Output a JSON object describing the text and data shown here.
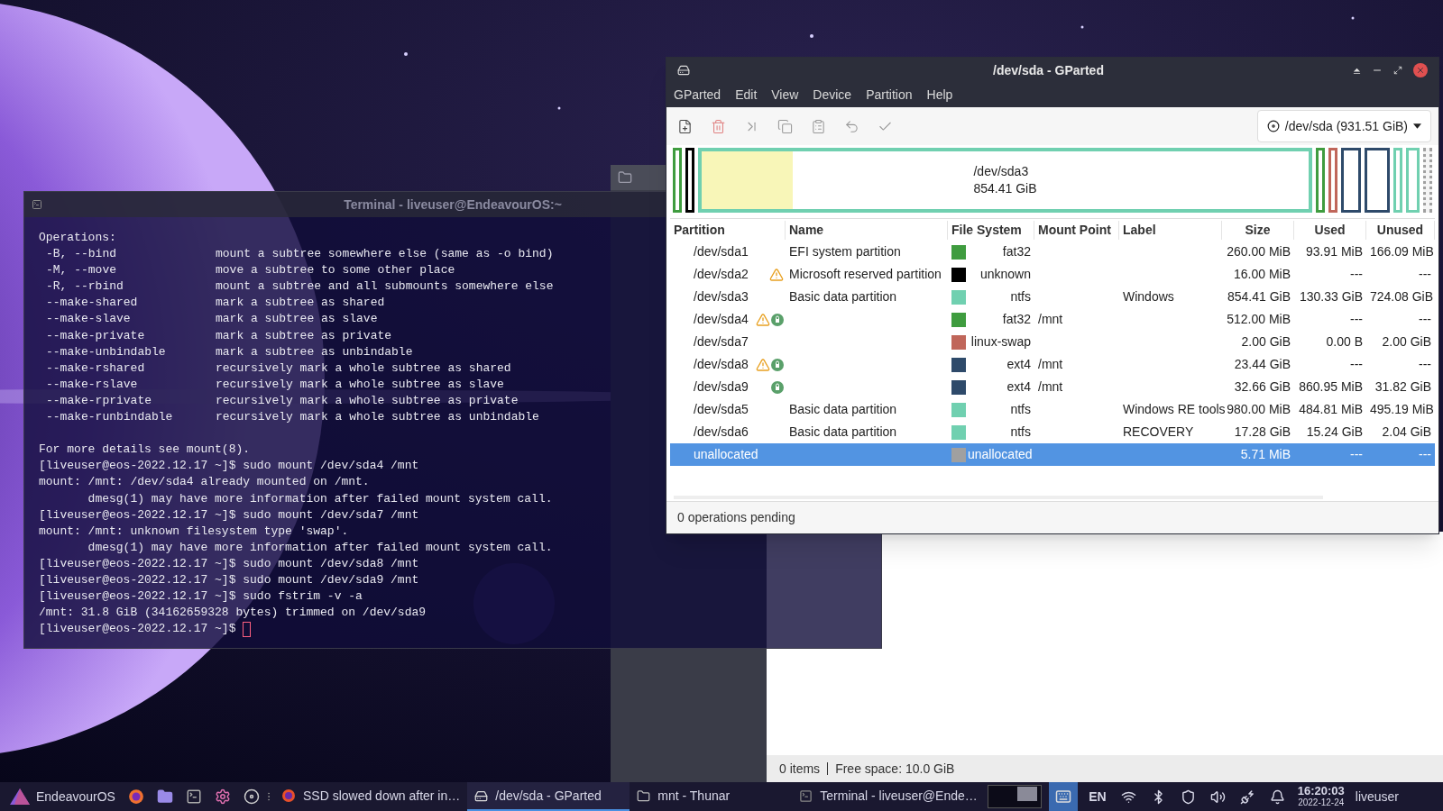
{
  "terminal": {
    "title": "Terminal - liveuser@EndeavourOS:~",
    "lines": [
      {
        "kind": "text",
        "text": "Operations:"
      },
      {
        "kind": "option",
        "option": "-B, --bind",
        "description": "mount a subtree somewhere else (same as -o bind)"
      },
      {
        "kind": "option",
        "option": "-M, --move",
        "description": "move a subtree to some other place"
      },
      {
        "kind": "option",
        "option": "-R, --rbind",
        "description": "mount a subtree and all submounts somewhere else"
      },
      {
        "kind": "option",
        "option": "--make-shared",
        "description": "mark a subtree as shared"
      },
      {
        "kind": "option",
        "option": "--make-slave",
        "description": "mark a subtree as slave"
      },
      {
        "kind": "option",
        "option": "--make-private",
        "description": "mark a subtree as private"
      },
      {
        "kind": "option",
        "option": "--make-unbindable",
        "description": "mark a subtree as unbindable"
      },
      {
        "kind": "option",
        "option": "--make-rshared",
        "description": "recursively mark a whole subtree as shared"
      },
      {
        "kind": "option",
        "option": "--make-rslave",
        "description": "recursively mark a whole subtree as slave"
      },
      {
        "kind": "option",
        "option": "--make-rprivate",
        "description": "recursively mark a whole subtree as private"
      },
      {
        "kind": "option",
        "option": "--make-runbindable",
        "description": "recursively mark a whole subtree as unbindable"
      },
      {
        "kind": "gap"
      },
      {
        "kind": "text",
        "text": "For more details see mount(8)."
      },
      {
        "kind": "text",
        "text": "[liveuser@eos-2022.12.17 ~]$ sudo mount /dev/sda4 /mnt"
      },
      {
        "kind": "text",
        "text": "mount: /mnt: /dev/sda4 already mounted on /mnt."
      },
      {
        "kind": "text",
        "text": "       dmesg(1) may have more information after failed mount system call."
      },
      {
        "kind": "text",
        "text": "[liveuser@eos-2022.12.17 ~]$ sudo mount /dev/sda7 /mnt"
      },
      {
        "kind": "text",
        "text": "mount: /mnt: unknown filesystem type 'swap'."
      },
      {
        "kind": "text",
        "text": "       dmesg(1) may have more information after failed mount system call."
      },
      {
        "kind": "text",
        "text": "[liveuser@eos-2022.12.17 ~]$ sudo mount /dev/sda8 /mnt"
      },
      {
        "kind": "text",
        "text": "[liveuser@eos-2022.12.17 ~]$ sudo mount /dev/sda9 /mnt"
      },
      {
        "kind": "text",
        "text": "[liveuser@eos-2022.12.17 ~]$ sudo fstrim -v -a"
      },
      {
        "kind": "text",
        "text": "/mnt: 31.8 GiB (34162659328 bytes) trimmed on /dev/sda9"
      },
      {
        "kind": "prompt",
        "text": "[liveuser@eos-2022.12.17 ~]$",
        "cursor": true
      }
    ]
  },
  "thunar": {
    "items": "0 items",
    "free_space": "Free space: 10.0 GiB"
  },
  "gparted": {
    "title": "/dev/sda - GParted",
    "menu": [
      "GParted",
      "Edit",
      "View",
      "Device",
      "Partition",
      "Help"
    ],
    "device": "/dev/sda (931.51 GiB)",
    "disk_map": [
      {
        "kind": "narrow",
        "color": "#3f9c3f"
      },
      {
        "kind": "narrow",
        "color": "#000000"
      },
      {
        "kind": "main",
        "color": "#70d0b0",
        "level": 0.15,
        "label": "/dev/sda3",
        "size": "854.41 GiB"
      },
      {
        "kind": "narrow",
        "color": "#3f9c3f"
      },
      {
        "kind": "narrow",
        "color": "#c0665a"
      },
      {
        "kind": "wide",
        "color": "#2e4a6a"
      },
      {
        "kind": "wider",
        "color": "#2e4a6a"
      },
      {
        "kind": "narrow",
        "color": "#70d0b0"
      },
      {
        "kind": "medium",
        "color": "#70d0b0"
      },
      {
        "kind": "free",
        "color": "#a0a0a0"
      }
    ],
    "columns": [
      "Partition",
      "Name",
      "File System",
      "Mount Point",
      "Label",
      "Size",
      "Used",
      "Unused"
    ],
    "rows": [
      {
        "partition": "/dev/sda1",
        "warning": false,
        "mounted": false,
        "name": "EFI system partition",
        "color": "#3f9c3f",
        "file_system": "fat32",
        "size": "260.00 MiB",
        "used": "93.91 MiB",
        "unused": "166.09 MiB",
        "selected": false
      },
      {
        "partition": "/dev/sda2",
        "warning": true,
        "mounted": false,
        "name": "Microsoft reserved partition",
        "color": "#000000",
        "file_system": "unknown",
        "size": "16.00 MiB",
        "used": "---",
        "unused": "---",
        "selected": false
      },
      {
        "partition": "/dev/sda3",
        "warning": false,
        "mounted": false,
        "name": "Basic data partition",
        "color": "#70d0b0",
        "file_system": "ntfs",
        "label": "Windows",
        "size": "854.41 GiB",
        "used": "130.33 GiB",
        "unused": "724.08 GiB",
        "selected": false
      },
      {
        "partition": "/dev/sda4",
        "warning": true,
        "mounted": true,
        "color": "#3f9c3f",
        "file_system": "fat32",
        "mount_point": "/mnt",
        "size": "512.00 MiB",
        "used": "---",
        "unused": "---",
        "selected": false
      },
      {
        "partition": "/dev/sda7",
        "warning": false,
        "mounted": false,
        "color": "#c0665a",
        "file_system": "linux-swap",
        "size": "2.00 GiB",
        "used": "0.00 B",
        "unused": "2.00 GiB",
        "selected": false
      },
      {
        "partition": "/dev/sda8",
        "warning": true,
        "mounted": true,
        "color": "#2e4a6a",
        "file_system": "ext4",
        "mount_point": "/mnt",
        "size": "23.44 GiB",
        "used": "---",
        "unused": "---",
        "selected": false
      },
      {
        "partition": "/dev/sda9",
        "warning": false,
        "mounted": true,
        "color": "#2e4a6a",
        "file_system": "ext4",
        "mount_point": "/mnt",
        "size": "32.66 GiB",
        "used": "860.95 MiB",
        "unused": "31.82 GiB",
        "selected": false
      },
      {
        "partition": "/dev/sda5",
        "warning": false,
        "mounted": false,
        "name": "Basic data partition",
        "color": "#70d0b0",
        "file_system": "ntfs",
        "label": "Windows RE tools",
        "size": "980.00 MiB",
        "used": "484.81 MiB",
        "unused": "495.19 MiB",
        "selected": false
      },
      {
        "partition": "/dev/sda6",
        "warning": false,
        "mounted": false,
        "name": "Basic data partition",
        "color": "#70d0b0",
        "file_system": "ntfs",
        "label": "RECOVERY",
        "size": "17.28 GiB",
        "used": "15.24 GiB",
        "unused": "2.04 GiB",
        "selected": false
      },
      {
        "partition": "unallocated",
        "warning": false,
        "mounted": false,
        "color": "#a0a0a0",
        "file_system": "unallocated",
        "size": "5.71 MiB",
        "used": "---",
        "unused": "---",
        "selected": true
      }
    ],
    "status": "0 operations pending"
  },
  "taskbar": {
    "start": "EndeavourOS",
    "tasks": [
      {
        "kind": "browser",
        "label": "SSD slowed down after in…",
        "selected": false
      },
      {
        "kind": "disk",
        "label": "/dev/sda - GParted",
        "selected": true
      },
      {
        "kind": "folder",
        "label": "mnt - Thunar",
        "selected": false
      },
      {
        "kind": "terminal",
        "label": "Terminal - liveuser@Ende…",
        "selected": false
      }
    ],
    "language": "EN",
    "time": "16:20:03",
    "date": "2022-12-24",
    "user": "liveuser"
  }
}
